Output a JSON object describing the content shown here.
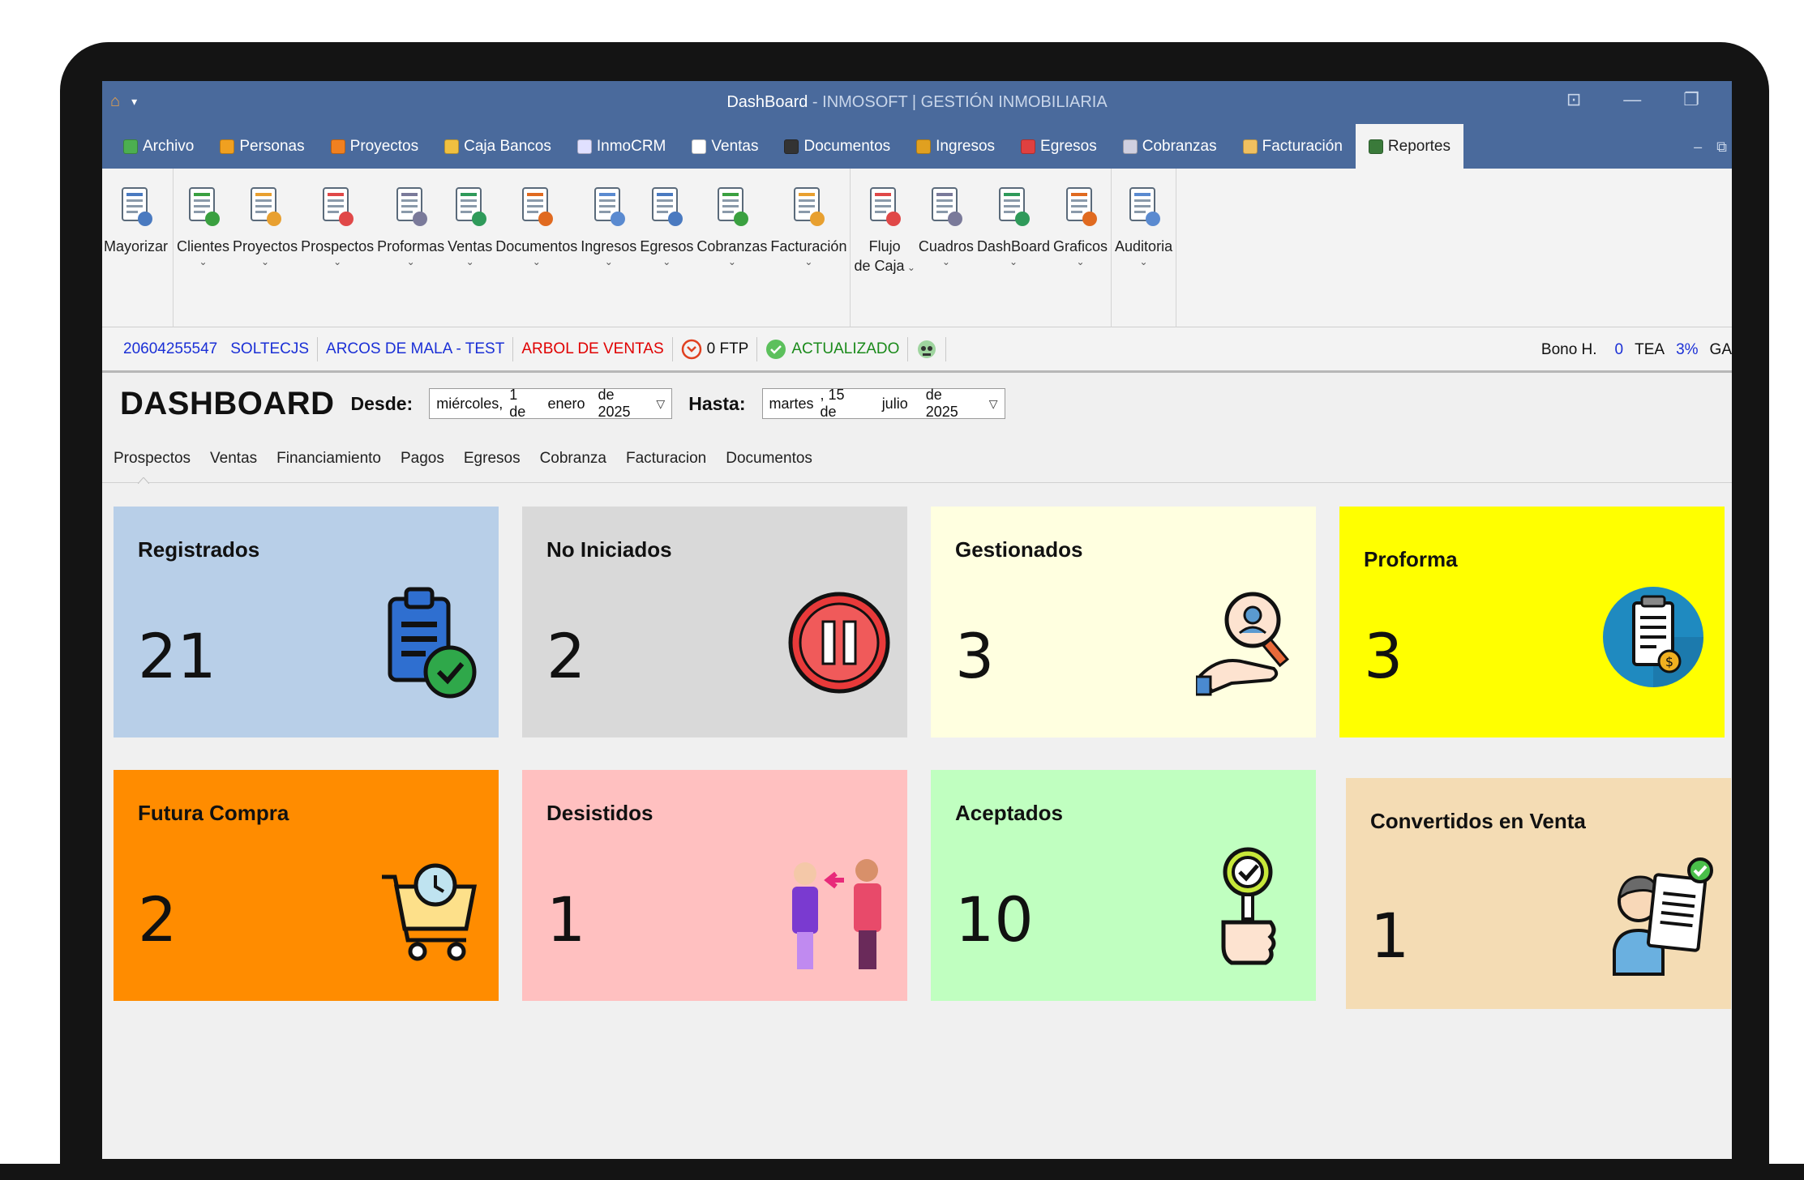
{
  "window": {
    "title_main": "DashBoard",
    "title_sub": " - INMOSOFT | GESTIÓN INMOBILIARIA"
  },
  "tabs": [
    {
      "label": "Archivo",
      "color": "#4caf50"
    },
    {
      "label": "Personas",
      "color": "#f0a020"
    },
    {
      "label": "Proyectos",
      "color": "#f08020"
    },
    {
      "label": "Caja Bancos",
      "color": "#f0c040"
    },
    {
      "label": "InmoCRM",
      "color": "#e0e0ff"
    },
    {
      "label": "Ventas",
      "color": "#ffffff"
    },
    {
      "label": "Documentos",
      "color": "#333333"
    },
    {
      "label": "Ingresos",
      "color": "#e0a020"
    },
    {
      "label": "Egresos",
      "color": "#e04040"
    },
    {
      "label": "Cobranzas",
      "color": "#d0d0e0"
    },
    {
      "label": "Facturación",
      "color": "#f0c060"
    },
    {
      "label": "Reportes",
      "color": "#3a7a3a"
    }
  ],
  "ribbon": {
    "groups": [
      [
        {
          "label": "Mayorizar",
          "chev": false
        }
      ],
      [
        {
          "label": "Clientes",
          "chev": true
        },
        {
          "label": "Proyectos",
          "chev": true
        },
        {
          "label": "Prospectos",
          "chev": true
        },
        {
          "label": "Proformas",
          "chev": true
        },
        {
          "label": "Ventas",
          "chev": true
        },
        {
          "label": "Documentos",
          "chev": true
        },
        {
          "label": "Ingresos",
          "chev": true
        },
        {
          "label": "Egresos",
          "chev": true
        },
        {
          "label": "Cobranzas",
          "chev": true
        },
        {
          "label": "Facturación",
          "chev": true
        }
      ],
      [
        {
          "label": "Flujo",
          "label2": "de Caja",
          "chev": true
        },
        {
          "label": "Cuadros",
          "chev": true
        },
        {
          "label": "DashBoard",
          "chev": true
        },
        {
          "label": "Graficos",
          "chev": true
        }
      ],
      [
        {
          "label": "Auditoria",
          "chev": true
        }
      ]
    ]
  },
  "status": {
    "ruc": "20604255547",
    "company": "SOLTECJS",
    "project": "ARCOS DE MALA - TEST",
    "tree": "ARBOL DE VENTAS",
    "ftp": "0 FTP",
    "updated": "ACTUALIZADO",
    "bono_label": "Bono H.",
    "bono_value": "0",
    "tea_label": "TEA",
    "tea_value": "3%",
    "extra": "GA"
  },
  "dashboard": {
    "title": "DASHBOARD",
    "from_label": "Desde:",
    "from_date": {
      "day_name": "miércoles,",
      "day": "1 de",
      "month": "enero",
      "year": "de 2025"
    },
    "to_label": "Hasta:",
    "to_date": {
      "day_name": "martes",
      "day": ", 15 de",
      "month": "julio",
      "year": "de 2025"
    }
  },
  "subtabs": [
    "Prospectos",
    "Ventas",
    "Financiamiento",
    "Pagos",
    "Egresos",
    "Cobranza",
    "Facturacion",
    "Documentos"
  ],
  "cards": [
    {
      "title": "Registrados",
      "value": "21",
      "bg": "#b8cfe8",
      "icon": "clipboard-check-icon"
    },
    {
      "title": "No Iniciados",
      "value": "2",
      "bg": "#d9d9d9",
      "icon": "pause-icon"
    },
    {
      "title": "Gestionados",
      "value": "3",
      "bg": "#ffffe0",
      "icon": "search-person-icon"
    },
    {
      "title": "Proforma",
      "value": "3",
      "bg": "#ffff00",
      "icon": "document-money-icon"
    },
    {
      "title": "Futura Compra",
      "value": "2",
      "bg": "#ff8c00",
      "icon": "cart-clock-icon"
    },
    {
      "title": "Desistidos",
      "value": "1",
      "bg": "#ffc0c0",
      "icon": "people-leave-icon"
    },
    {
      "title": "Aceptados",
      "value": "10",
      "bg": "#c0ffc0",
      "icon": "approval-hand-icon"
    },
    {
      "title": "Convertidos en Venta",
      "value": "1",
      "bg": "#f4dcb4",
      "icon": "person-contract-icon"
    }
  ]
}
